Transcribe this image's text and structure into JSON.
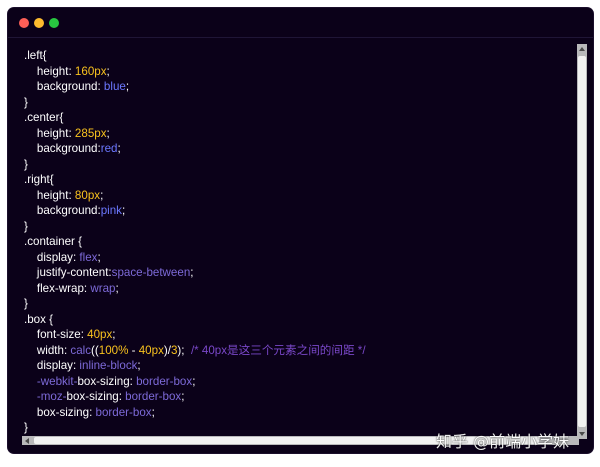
{
  "window": {
    "traffic_lights": {
      "close": "#fd5f57",
      "minimize": "#febc2e",
      "zoom": "#28c840"
    },
    "background": "#0b0119"
  },
  "code_lines": [
    [
      {
        "t": ".left{",
        "c": "plain"
      }
    ],
    [
      {
        "t": "    height: ",
        "c": "plain"
      },
      {
        "t": "160px",
        "c": "num"
      },
      {
        "t": ";",
        "c": "plain"
      }
    ],
    [
      {
        "t": "    background: ",
        "c": "plain"
      },
      {
        "t": "blue",
        "c": "blue"
      },
      {
        "t": ";",
        "c": "plain"
      }
    ],
    [
      {
        "t": "}",
        "c": "plain"
      }
    ],
    [
      {
        "t": ".center{",
        "c": "plain"
      }
    ],
    [
      {
        "t": "    height: ",
        "c": "plain"
      },
      {
        "t": "285px",
        "c": "num"
      },
      {
        "t": ";",
        "c": "plain"
      }
    ],
    [
      {
        "t": "    background:",
        "c": "plain"
      },
      {
        "t": "red",
        "c": "blue"
      },
      {
        "t": ";",
        "c": "plain"
      }
    ],
    [
      {
        "t": "}",
        "c": "plain"
      }
    ],
    [
      {
        "t": ".right{",
        "c": "plain"
      }
    ],
    [
      {
        "t": "    height: ",
        "c": "plain"
      },
      {
        "t": "80px",
        "c": "num"
      },
      {
        "t": ";",
        "c": "plain"
      }
    ],
    [
      {
        "t": "    background:",
        "c": "plain"
      },
      {
        "t": "pink",
        "c": "blue"
      },
      {
        "t": ";",
        "c": "plain"
      }
    ],
    [
      {
        "t": "}",
        "c": "plain"
      }
    ],
    [
      {
        "t": ".container {",
        "c": "plain"
      }
    ],
    [
      {
        "t": "    display: ",
        "c": "plain"
      },
      {
        "t": "flex",
        "c": "val"
      },
      {
        "t": ";",
        "c": "plain"
      }
    ],
    [
      {
        "t": "    justify-content:",
        "c": "plain"
      },
      {
        "t": "space-between",
        "c": "val"
      },
      {
        "t": ";",
        "c": "plain"
      }
    ],
    [
      {
        "t": "    flex-wrap: ",
        "c": "plain"
      },
      {
        "t": "wrap",
        "c": "val"
      },
      {
        "t": ";",
        "c": "plain"
      }
    ],
    [
      {
        "t": "}",
        "c": "plain"
      }
    ],
    [
      {
        "t": ".box {",
        "c": "plain"
      }
    ],
    [
      {
        "t": "    font-size: ",
        "c": "plain"
      },
      {
        "t": "40px",
        "c": "num"
      },
      {
        "t": ";",
        "c": "plain"
      }
    ],
    [
      {
        "t": "    width: ",
        "c": "plain"
      },
      {
        "t": "calc",
        "c": "val"
      },
      {
        "t": "((",
        "c": "plain"
      },
      {
        "t": "100%",
        "c": "num"
      },
      {
        "t": " - ",
        "c": "plain"
      },
      {
        "t": "40px",
        "c": "num"
      },
      {
        "t": ")/",
        "c": "plain"
      },
      {
        "t": "3",
        "c": "num"
      },
      {
        "t": ");  ",
        "c": "plain"
      },
      {
        "t": "/* 40px是这三个元素之间的间距 */",
        "c": "comment"
      }
    ],
    [
      {
        "t": "    display: ",
        "c": "plain"
      },
      {
        "t": "inline-block",
        "c": "val"
      },
      {
        "t": ";",
        "c": "plain"
      }
    ],
    [
      {
        "t": "    -webkit-",
        "c": "val"
      },
      {
        "t": "box-sizing: ",
        "c": "plain"
      },
      {
        "t": "border-box",
        "c": "val"
      },
      {
        "t": ";",
        "c": "plain"
      }
    ],
    [
      {
        "t": "    -moz-",
        "c": "val"
      },
      {
        "t": "box-sizing: ",
        "c": "plain"
      },
      {
        "t": "border-box",
        "c": "val"
      },
      {
        "t": ";",
        "c": "plain"
      }
    ],
    [
      {
        "t": "    box-sizing: ",
        "c": "plain"
      },
      {
        "t": "border-box",
        "c": "val"
      },
      {
        "t": ";",
        "c": "plain"
      }
    ],
    [
      {
        "t": "}",
        "c": "plain"
      }
    ]
  ],
  "syntax_colors": {
    "plain": "#ffffff",
    "num": "#f9c21e",
    "val": "#7d6ad8",
    "blue": "#6c78ff",
    "comment": "#7a48c9"
  },
  "watermark": {
    "text": "知乎 @前端小学妹"
  }
}
